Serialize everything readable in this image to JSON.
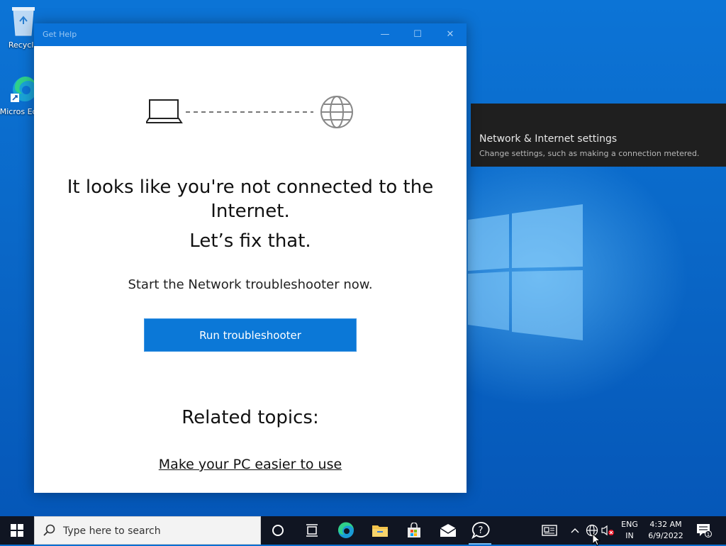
{
  "desktop": {
    "icons": [
      {
        "label": "Recycle"
      },
      {
        "label": "Micros Edge"
      }
    ]
  },
  "flyout": {
    "title": "Network & Internet settings",
    "subtitle": "Change settings, such as making a connection metered."
  },
  "window": {
    "title": "Get Help",
    "controls": {
      "minimize": "—",
      "maximize": "☐",
      "close": "✕"
    },
    "headline": "It looks like you're not connected to the Internet.",
    "fix": "Let’s fix that.",
    "subtext": "Start the Network troubleshooter now.",
    "run_button": "Run troubleshooter",
    "related_heading": "Related topics:",
    "related_link": "Make your PC easier to use"
  },
  "taskbar": {
    "search_placeholder": "Type here to search",
    "apps": [
      "cortana-icon",
      "task-view-icon",
      "edge-icon",
      "file-explorer-icon",
      "store-icon",
      "mail-icon",
      "get-help-icon"
    ],
    "tray": {
      "lang_line1": "ENG",
      "lang_line2": "IN",
      "time": "4:32 AM",
      "date": "6/9/2022",
      "notifications_count": "1"
    }
  },
  "colors": {
    "accent": "#0b78d7",
    "titlebar": "#0a72d8",
    "taskbar": "#101522",
    "flyout_bg": "#1f1f1f"
  }
}
